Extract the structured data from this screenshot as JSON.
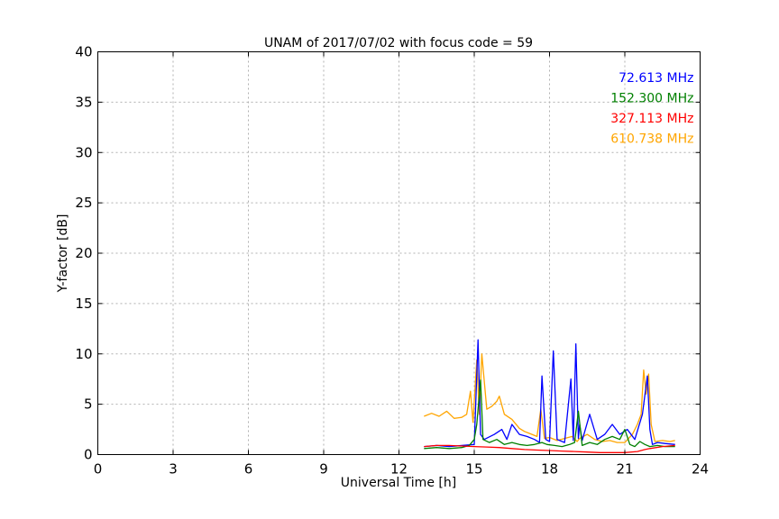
{
  "chart_data": {
    "type": "line",
    "title": "UNAM of 2017/07/02 with focus code = 59",
    "xlabel": "Universal Time [h]",
    "ylabel": "Y-factor [dB]",
    "xlim": [
      0,
      24
    ],
    "ylim": [
      0,
      40
    ],
    "xticks": [
      0,
      3,
      6,
      9,
      12,
      15,
      18,
      21,
      24
    ],
    "yticks": [
      0,
      5,
      10,
      15,
      20,
      25,
      30,
      35,
      40
    ],
    "grid": true,
    "legend_position": "top-right",
    "series": [
      {
        "name": "610.738 MHz",
        "color": "#ffa500",
        "x": [
          13.0,
          13.3,
          13.6,
          13.9,
          14.2,
          14.5,
          14.7,
          14.85,
          14.95,
          15.1,
          15.2,
          15.3,
          15.5,
          15.7,
          15.9,
          16.0,
          16.2,
          16.5,
          16.8,
          17.0,
          17.3,
          17.5,
          17.65,
          17.8,
          18.0,
          18.3,
          18.6,
          18.9,
          19.1,
          19.2,
          19.5,
          19.8,
          20.1,
          20.4,
          20.7,
          21.0,
          21.3,
          21.5,
          21.65,
          21.75,
          21.85,
          21.95,
          22.05,
          22.2,
          22.5,
          22.8,
          23.0
        ],
        "y": [
          3.8,
          4.1,
          3.8,
          4.3,
          3.6,
          3.7,
          4.0,
          6.3,
          3.2,
          9.4,
          4.0,
          10.0,
          4.5,
          4.8,
          5.3,
          5.8,
          4.0,
          3.5,
          2.6,
          2.3,
          2.0,
          1.8,
          4.5,
          1.6,
          1.7,
          1.4,
          1.6,
          1.8,
          1.3,
          1.6,
          2.0,
          1.5,
          1.3,
          1.4,
          1.2,
          1.2,
          2.0,
          3.0,
          4.0,
          8.4,
          6.0,
          8.0,
          3.0,
          1.3,
          1.4,
          1.3,
          1.4
        ]
      },
      {
        "name": "72.613 MHz",
        "color": "#0000ff",
        "x": [
          13.0,
          13.5,
          14.0,
          14.5,
          15.0,
          15.15,
          15.25,
          15.4,
          15.8,
          16.1,
          16.3,
          16.5,
          16.8,
          17.1,
          17.4,
          17.6,
          17.7,
          17.85,
          18.0,
          18.15,
          18.3,
          18.6,
          18.85,
          18.95,
          19.05,
          19.15,
          19.2,
          19.3,
          19.6,
          19.9,
          20.2,
          20.5,
          20.8,
          21.1,
          21.4,
          21.7,
          21.9,
          22.0,
          22.1,
          22.3,
          22.6,
          23.0
        ],
        "y": [
          0.8,
          0.9,
          0.8,
          0.9,
          1.0,
          11.4,
          2.0,
          1.5,
          2.0,
          2.5,
          1.5,
          3.0,
          2.0,
          1.8,
          1.5,
          1.2,
          7.8,
          1.5,
          1.3,
          10.3,
          1.5,
          1.2,
          7.5,
          1.4,
          11.0,
          1.6,
          3.0,
          1.4,
          4.0,
          1.5,
          2.0,
          3.0,
          2.0,
          2.5,
          1.5,
          4.0,
          7.8,
          2.5,
          1.0,
          1.2,
          1.1,
          1.0
        ]
      },
      {
        "name": "152.300 MHz",
        "color": "#008000",
        "x": [
          13.0,
          13.5,
          14.0,
          14.5,
          14.8,
          15.0,
          15.1,
          15.25,
          15.35,
          15.6,
          15.9,
          16.2,
          16.5,
          16.8,
          17.1,
          17.4,
          17.7,
          17.9,
          18.2,
          18.5,
          18.8,
          19.0,
          19.15,
          19.3,
          19.6,
          19.9,
          20.2,
          20.5,
          20.8,
          21.0,
          21.2,
          21.4,
          21.6,
          21.8,
          22.0,
          22.3,
          22.6,
          23.0
        ],
        "y": [
          0.6,
          0.7,
          0.6,
          0.7,
          0.9,
          1.5,
          3.0,
          7.4,
          1.5,
          1.2,
          1.5,
          1.0,
          1.2,
          1.0,
          0.9,
          1.0,
          1.2,
          1.0,
          0.9,
          0.8,
          1.0,
          1.2,
          4.3,
          0.9,
          1.2,
          1.0,
          1.5,
          1.8,
          1.5,
          2.5,
          1.0,
          0.8,
          1.3,
          1.0,
          0.8,
          0.9,
          0.8,
          0.8
        ]
      },
      {
        "name": "327.113 MHz",
        "color": "#ff0000",
        "x": [
          13.0,
          13.5,
          14.0,
          14.5,
          15.0,
          15.5,
          16.0,
          16.5,
          17.0,
          17.5,
          18.0,
          18.5,
          19.0,
          19.5,
          20.0,
          20.5,
          21.0,
          21.5,
          21.8,
          22.0,
          22.5,
          23.0
        ],
        "y": [
          0.8,
          0.9,
          0.9,
          0.85,
          0.8,
          0.75,
          0.7,
          0.6,
          0.5,
          0.45,
          0.4,
          0.35,
          0.3,
          0.25,
          0.2,
          0.2,
          0.2,
          0.3,
          0.5,
          0.6,
          0.8,
          0.9
        ]
      }
    ],
    "legend": [
      {
        "label": "72.613 MHz",
        "color": "#0000ff"
      },
      {
        "label": "152.300 MHz",
        "color": "#008000"
      },
      {
        "label": "327.113 MHz",
        "color": "#ff0000"
      },
      {
        "label": "610.738 MHz",
        "color": "#ffa500"
      }
    ]
  }
}
